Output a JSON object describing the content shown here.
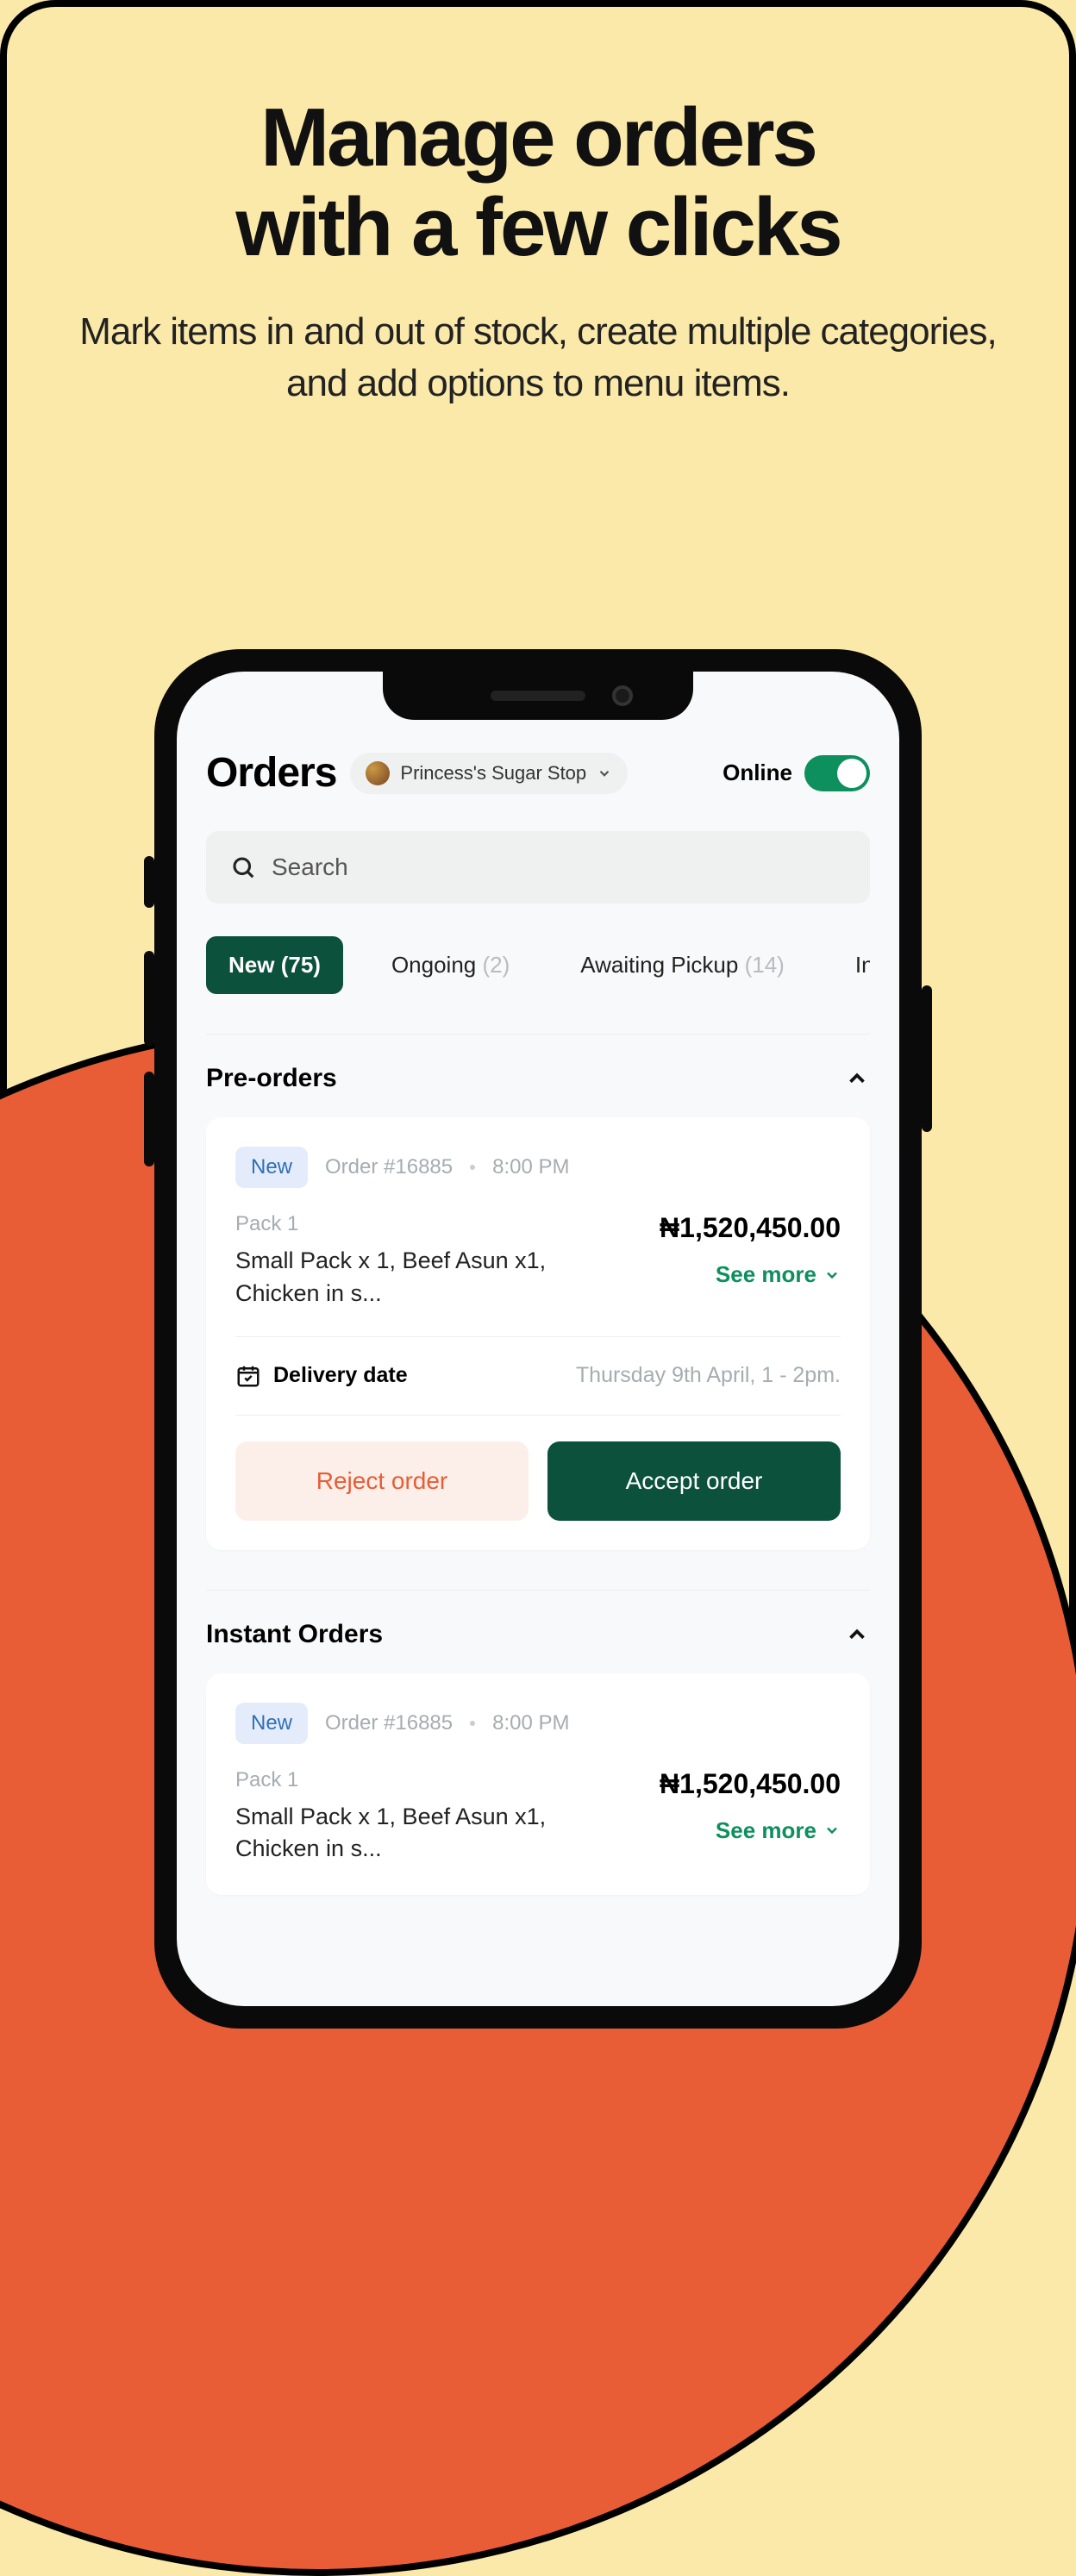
{
  "hero": {
    "title_line1": "Manage orders",
    "title_line2": "with a few clicks",
    "subtitle": "Mark items in and out of stock, create multiple categories, and add options to menu items."
  },
  "app": {
    "title": "Orders",
    "store_name": "Princess's Sugar Stop",
    "online_label": "Online",
    "search_placeholder": "Search",
    "tabs": [
      {
        "label": "New",
        "count": "(75)",
        "active": true
      },
      {
        "label": "Ongoing",
        "count": "(2)",
        "active": false
      },
      {
        "label": "Awaiting Pickup",
        "count": "(14)",
        "active": false
      },
      {
        "label": "In Transit",
        "count": "(",
        "active": false
      }
    ],
    "sections": {
      "preorders": {
        "title": "Pre-orders",
        "card": {
          "badge": "New",
          "order_number": "Order #16885",
          "time": "8:00 PM",
          "pack_label": "Pack 1",
          "items_text": "Small Pack x 1, Beef Asun x1, Chicken in s...",
          "price": "₦1,520,450.00",
          "see_more": "See more",
          "delivery_label": "Delivery date",
          "delivery_value": "Thursday 9th April, 1 - 2pm.",
          "reject_label": "Reject order",
          "accept_label": "Accept order"
        }
      },
      "instant": {
        "title": "Instant Orders",
        "card": {
          "badge": "New",
          "order_number": "Order #16885",
          "time": "8:00 PM",
          "pack_label": "Pack 1",
          "items_text": "Small Pack x 1, Beef Asun x1, Chicken in s...",
          "price": "₦1,520,450.00",
          "see_more": "See more"
        }
      }
    }
  }
}
